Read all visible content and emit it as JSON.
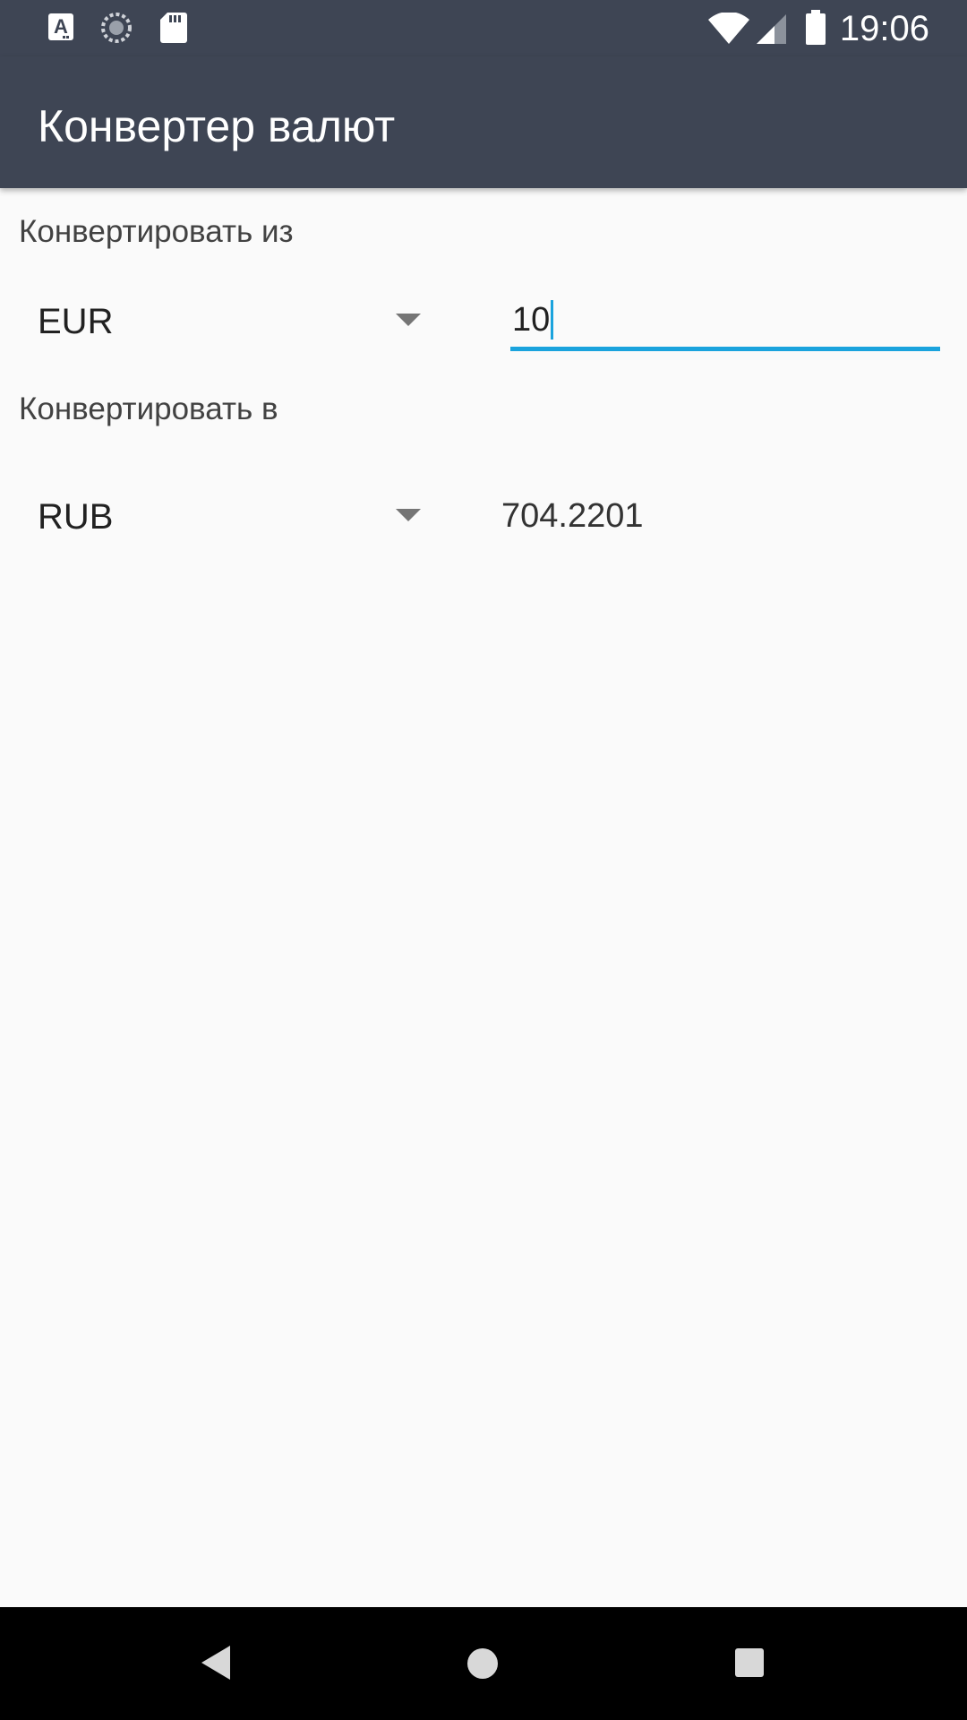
{
  "status_bar": {
    "time": "19:06",
    "icons": [
      "keyboard-a-icon",
      "sync-loading-icon",
      "sd-card-icon",
      "wifi-icon",
      "cell-signal-icon",
      "battery-icon"
    ]
  },
  "app_bar": {
    "title": "Конвертер валют"
  },
  "from_section": {
    "label": "Конвертировать из",
    "currency": "EUR",
    "amount": "10"
  },
  "to_section": {
    "label": "Конвертировать в",
    "currency": "RUB",
    "result": "704.2201"
  },
  "colors": {
    "app_bar": "#3e4554",
    "accent": "#1aa3dd",
    "background": "#fafafa",
    "nav_bar": "#000000"
  },
  "nav_bar": {
    "buttons": [
      "back-icon",
      "home-icon",
      "recents-icon"
    ]
  }
}
